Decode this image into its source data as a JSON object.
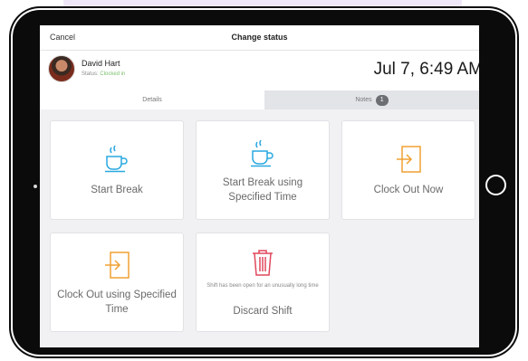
{
  "header": {
    "cancel_label": "Cancel",
    "title": "Change status"
  },
  "user": {
    "name": "David Hart",
    "status_label": "Status:",
    "status_value": "Clocked in"
  },
  "datetime": "Jul 7, 6:49 AM",
  "tabs": [
    {
      "label": "Details",
      "active": true
    },
    {
      "label": "Notes",
      "badge": "1"
    }
  ],
  "actions": [
    {
      "label": "Start Break",
      "icon": "coffee-cup-icon"
    },
    {
      "label": "Start Break using Specified Time",
      "icon": "coffee-cup-icon"
    },
    {
      "label": "Clock Out Now",
      "icon": "sign-out-icon"
    },
    {
      "label": "Clock Out using Specified Time",
      "icon": "sign-out-icon"
    },
    {
      "label": "Discard Shift",
      "note": "Shift has been open for an unusually long time",
      "icon": "trash-icon"
    }
  ],
  "colors": {
    "coffee": "#29a8e0",
    "clock_out": "#f0a132",
    "trash": "#e0475b",
    "status_green": "#7cc16e"
  }
}
